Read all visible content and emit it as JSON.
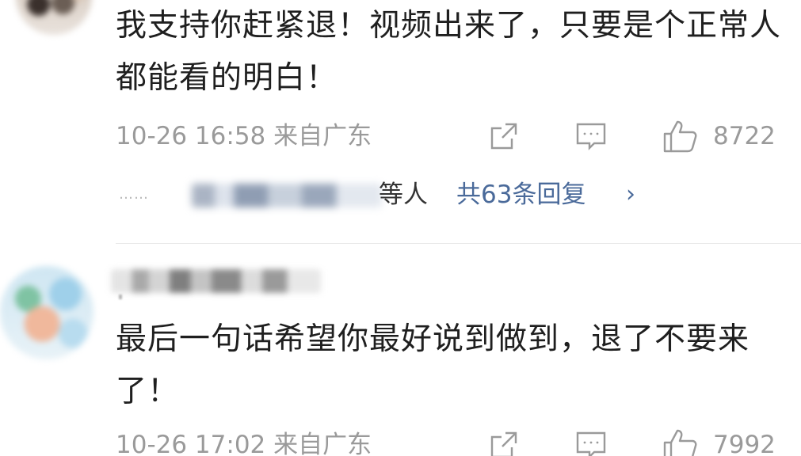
{
  "comments": [
    {
      "text": "我支持你赶紧退！视频出来了，只要是个正常人都能看的明白！",
      "time": "10-26 16:58 来自广东",
      "likes": "8722",
      "replies": {
        "dots": "……",
        "suffix": "等人",
        "count_label": "共63条回复",
        "chevron": "›"
      }
    },
    {
      "text": "最后一句话希望你最好说到做到，退了不要来了！",
      "time": "10-26 17:02 来自广东",
      "likes": "7992"
    }
  ],
  "icons": {
    "share": "share-icon",
    "comment": "comment-icon",
    "like": "thumbs-up-icon",
    "reply_more": "chevron-right-icon"
  },
  "colors": {
    "text_primary": "#1f1f1f",
    "text_meta": "#9a9a9a",
    "link": "#4a6a9a",
    "divider": "#e8e8e8"
  }
}
